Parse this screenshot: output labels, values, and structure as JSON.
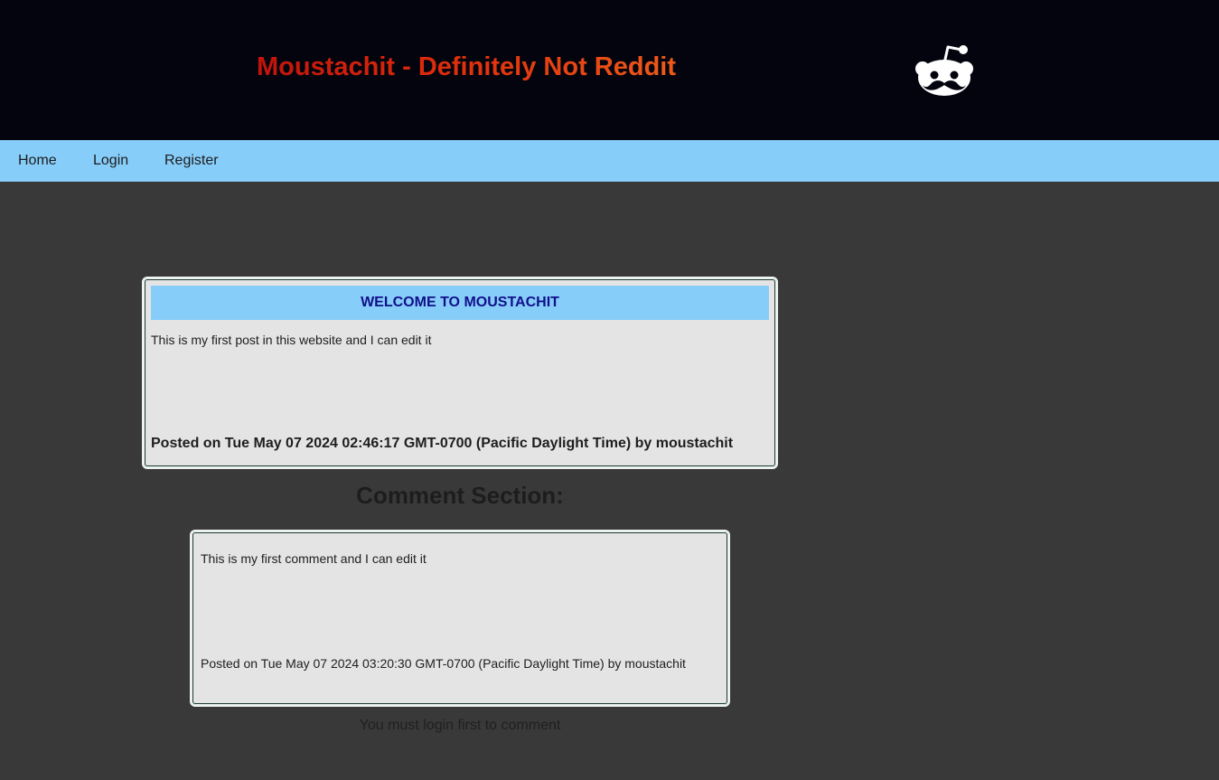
{
  "header": {
    "title": "Moustachit - Definitely Not Reddit",
    "logo_icon": "reddit-moustache-logo-icon"
  },
  "nav": {
    "items": [
      {
        "label": "Home"
      },
      {
        "label": "Login"
      },
      {
        "label": "Register"
      }
    ]
  },
  "post": {
    "title": "WELCOME TO MOUSTACHIT",
    "body": "This is my first post in this website and I can edit it",
    "meta": "Posted on Tue May 07 2024 02:46:17 GMT-0700 (Pacific Daylight Time) by moustachit"
  },
  "comments": {
    "heading": "Comment Section:",
    "items": [
      {
        "body": "This is my first comment and I can edit it",
        "meta": "Posted on Tue May 07 2024 03:20:30 GMT-0700 (Pacific Daylight Time) by moustachit"
      }
    ],
    "login_notice": "You must login first to comment"
  },
  "colors": {
    "header_bg": "#03040e",
    "nav_bg": "#87cdf9",
    "page_bg": "#393939",
    "card_bg": "#e4e4e4",
    "title_accent": "#e0300c",
    "post_title": "#10108a"
  }
}
